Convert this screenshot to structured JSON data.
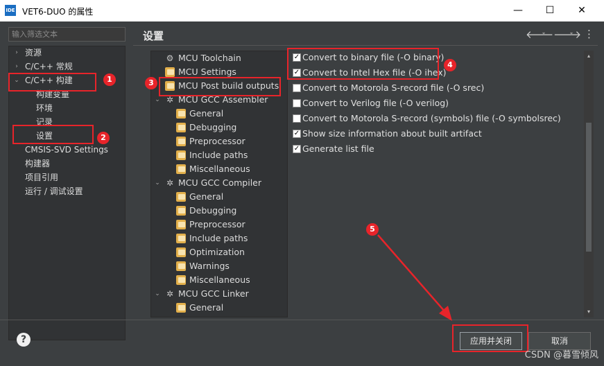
{
  "window": {
    "app_icon_label": "IDE",
    "title": "VET6-DUO 的属性",
    "minimize": "—",
    "maximize": "☐",
    "close": "✕"
  },
  "filter": {
    "placeholder": "输入筛选文本"
  },
  "nav": {
    "items": [
      {
        "label": "资源"
      },
      {
        "label": "C/C++ 常规"
      },
      {
        "label": "C/C++ 构建"
      },
      {
        "label": "构建变量"
      },
      {
        "label": "环境"
      },
      {
        "label": "记录"
      },
      {
        "label": "设置"
      },
      {
        "label": "CMSIS-SVD Settings"
      },
      {
        "label": "构建器"
      },
      {
        "label": "项目引用"
      },
      {
        "label": "运行 / 调试设置"
      }
    ]
  },
  "section": {
    "title": "设置"
  },
  "toolbar": {
    "back_icon": "🡐",
    "forward_icon": "🡒",
    "menu_icon": "⋮",
    "dropdown_icon": "▾"
  },
  "tool_tree": {
    "items": [
      {
        "label": "MCU Toolchain"
      },
      {
        "label": "MCU Settings"
      },
      {
        "label": "MCU Post build outputs"
      },
      {
        "label": "MCU GCC Assembler"
      },
      {
        "label": "General"
      },
      {
        "label": "Debugging"
      },
      {
        "label": "Preprocessor"
      },
      {
        "label": "Include paths"
      },
      {
        "label": "Miscellaneous"
      },
      {
        "label": "MCU GCC Compiler"
      },
      {
        "label": "General"
      },
      {
        "label": "Debugging"
      },
      {
        "label": "Preprocessor"
      },
      {
        "label": "Include paths"
      },
      {
        "label": "Optimization"
      },
      {
        "label": "Warnings"
      },
      {
        "label": "Miscellaneous"
      },
      {
        "label": "MCU GCC Linker"
      },
      {
        "label": "General"
      }
    ]
  },
  "options": [
    {
      "label": "Convert to binary file (-O binary)",
      "checked": true
    },
    {
      "label": "Convert to Intel Hex file (-O ihex)",
      "checked": true
    },
    {
      "label": "Convert to Motorola S-record file (-O srec)",
      "checked": false
    },
    {
      "label": "Convert to Verilog file (-O verilog)",
      "checked": false
    },
    {
      "label": "Convert to Motorola S-record (symbols) file (-O symbolsrec)",
      "checked": false
    },
    {
      "label": "Show size information about built artifact",
      "checked": true
    },
    {
      "label": "Generate list file",
      "checked": true
    }
  ],
  "footer": {
    "help_icon": "?",
    "apply_close": "应用并关闭",
    "cancel": "取消"
  },
  "annotations": {
    "badges": [
      "1",
      "2",
      "3",
      "4",
      "5"
    ],
    "color": "#e8242a"
  },
  "watermark": "CSDN @暮雪倾风"
}
